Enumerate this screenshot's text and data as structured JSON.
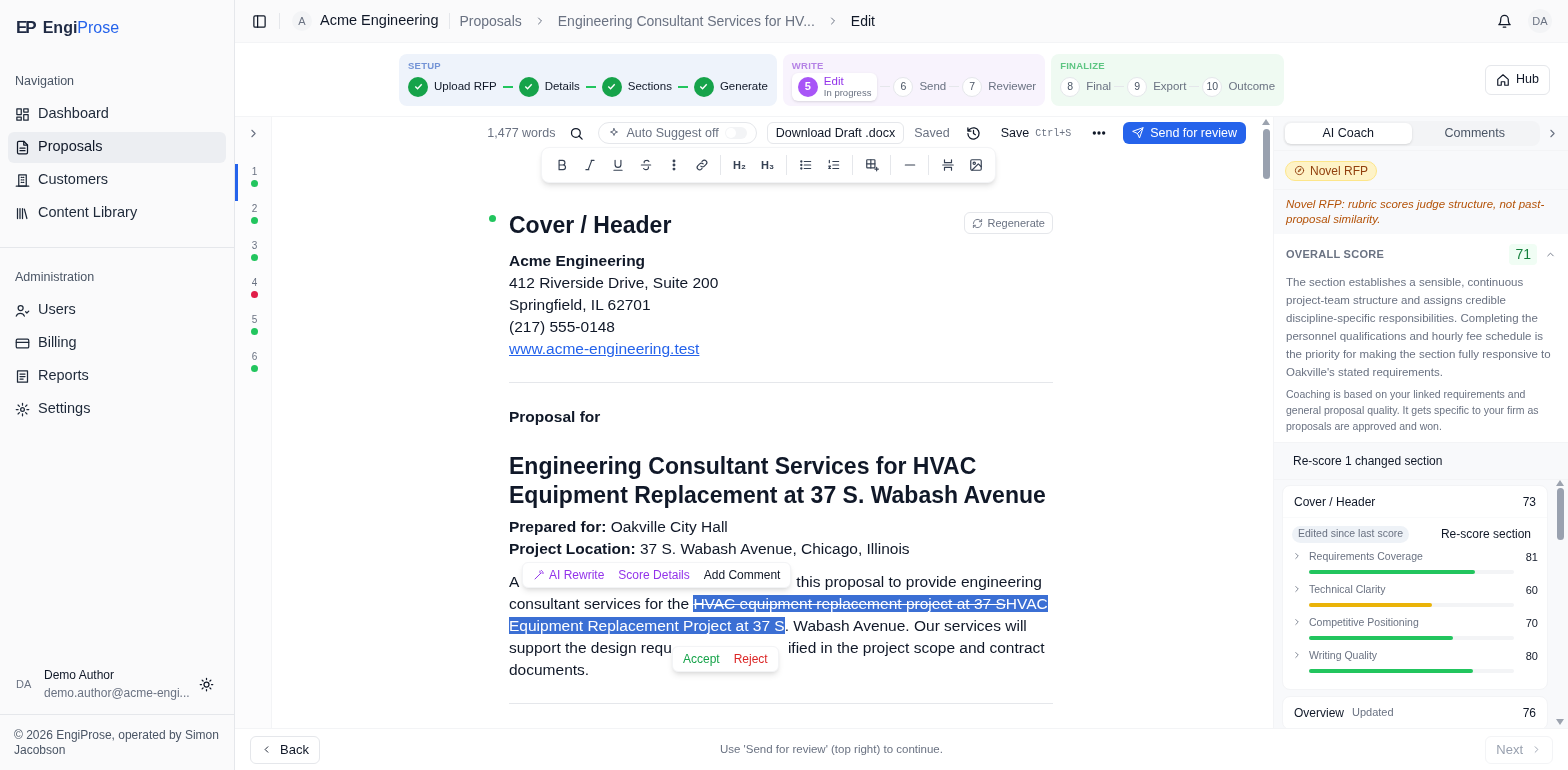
{
  "sidebar": {
    "logo_mark": "EP",
    "brand_first": "Engi",
    "brand_second": "Prose",
    "sections": [
      {
        "title": "Navigation",
        "items": [
          {
            "label": "Dashboard",
            "selected": false
          },
          {
            "label": "Proposals",
            "selected": true
          },
          {
            "label": "Customers",
            "selected": false
          },
          {
            "label": "Content Library",
            "selected": false
          }
        ]
      },
      {
        "title": "Administration",
        "items": [
          {
            "label": "Users",
            "selected": false
          },
          {
            "label": "Billing",
            "selected": false
          },
          {
            "label": "Reports",
            "selected": false
          },
          {
            "label": "Settings",
            "selected": false
          }
        ]
      }
    ],
    "user": {
      "initials": "DA",
      "name": "Demo Author",
      "email": "demo.author@acme-engi..."
    },
    "copyright": "© 2026 EngiProse, operated by Simon Jacobson"
  },
  "header": {
    "org_initial": "A",
    "org": "Acme Engineering",
    "breadcrumbs": [
      "Proposals",
      "Engineering Consultant Services for HV...",
      "Edit"
    ],
    "avatar": "DA"
  },
  "stepper": {
    "groups": [
      {
        "title": "SETUP",
        "steps": [
          {
            "label": "Upload RFP",
            "completed": true,
            "current": false
          },
          {
            "label": "Details",
            "completed": true,
            "current": false
          },
          {
            "label": "Sections",
            "completed": true,
            "current": false
          },
          {
            "label": "Generate",
            "completed": true,
            "current": false
          }
        ]
      },
      {
        "title": "WRITE",
        "steps": [
          {
            "number": "5",
            "label": "Edit",
            "sublabel": "In progress",
            "completed": false,
            "current": true
          },
          {
            "number": "6",
            "label": "Send",
            "completed": false,
            "current": false
          },
          {
            "number": "7",
            "label": "Reviewer",
            "completed": false,
            "current": false
          }
        ]
      },
      {
        "title": "FINALIZE",
        "steps": [
          {
            "number": "8",
            "label": "Final",
            "completed": false,
            "current": false
          },
          {
            "number": "9",
            "label": "Export",
            "completed": false,
            "current": false
          },
          {
            "number": "10",
            "label": "Outcome",
            "completed": false,
            "current": false
          }
        ]
      }
    ],
    "hub": "Hub"
  },
  "section_rail": [
    {
      "number": "1",
      "selected": true,
      "color": "#22c55e"
    },
    {
      "number": "2",
      "selected": false,
      "color": "#22c55e"
    },
    {
      "number": "3",
      "selected": false,
      "color": "#22c55e"
    },
    {
      "number": "4",
      "selected": false,
      "color": "#e11d48"
    },
    {
      "number": "5",
      "selected": false,
      "color": "#22c55e"
    },
    {
      "number": "6",
      "selected": false,
      "color": "#22c55e"
    }
  ],
  "editor_toolbar": {
    "word_count": "1,477 words",
    "auto_suggest": {
      "label": "Auto Suggest off",
      "on": false
    },
    "download": "Download Draft .docx",
    "save_state": "Saved",
    "save": "Save",
    "save_shortcut": "Ctrl+S",
    "send": "Send for review"
  },
  "format_toolbar": [
    {
      "kind": "bold"
    },
    {
      "kind": "italic"
    },
    {
      "kind": "underline"
    },
    {
      "kind": "strike"
    },
    {
      "kind": "more"
    },
    {
      "kind": "link"
    },
    {
      "kind": "sep"
    },
    {
      "kind": "heading",
      "text": "H₂"
    },
    {
      "kind": "heading",
      "text": "H₃"
    },
    {
      "kind": "sep"
    },
    {
      "kind": "bullets"
    },
    {
      "kind": "numbered"
    },
    {
      "kind": "sep"
    },
    {
      "kind": "table"
    },
    {
      "kind": "sep"
    },
    {
      "kind": "rule"
    },
    {
      "kind": "sep"
    },
    {
      "kind": "split"
    },
    {
      "kind": "image"
    }
  ],
  "document": {
    "section_title": "Cover / Header",
    "regenerate": "Regenerate",
    "address": [
      {
        "kind": "bold",
        "text": "Acme Engineering"
      },
      {
        "kind": "line",
        "text": "412 Riverside Drive, Suite 200"
      },
      {
        "kind": "line",
        "text": "Springfield, IL 62701"
      },
      {
        "kind": "line",
        "text": "(217) 555-0148"
      },
      {
        "kind": "link",
        "text": "www.acme-engineering.test"
      }
    ],
    "proposal_for": "Proposal for",
    "title": "Engineering Consultant Services for HVAC Equipment Replacement at 37 S. Wabash Avenue",
    "details": [
      "**Prepared for:** Oakville City Hall",
      "**Project Location:** 37 S. Wabash Avenue, Chicago, Illinois"
    ],
    "paragraph": [
      {
        "kind": "text",
        "text": "A"
      },
      {
        "kind": "selection_toolbar",
        "actions": [
          {
            "label": "AI Rewrite",
            "icon": true
          },
          {
            "label": "Score Details"
          },
          {
            "label": "Add Comment"
          }
        ]
      },
      {
        "kind": "text",
        "text": "this proposal to provide engineering consultant services for the "
      },
      {
        "kind": "deleted",
        "text": "HVAC equipment replacement project at 37 S"
      },
      {
        "kind": "inserted",
        "text": "HVAC Equipment Replacement Project at 37 S"
      },
      {
        "kind": "text",
        "text": ". Wabash Avenue. Our services will support the design requ"
      },
      {
        "kind": "review_toolbar",
        "actions": [
          {
            "label": "Accept"
          },
          {
            "label": "Reject"
          }
        ]
      },
      {
        "kind": "text",
        "text": "ified in the project scope and contract documents."
      }
    ]
  },
  "coach": {
    "tabs": [
      {
        "label": "AI Coach",
        "selected": true
      },
      {
        "label": "Comments",
        "selected": false
      }
    ],
    "badge": "Novel RFP",
    "note": "Novel RFP: rubric scores judge structure, not past-proposal similarity.",
    "overall": {
      "label": "OVERALL SCORE",
      "score": "71",
      "expanded": true,
      "summary": "The section establishes a sensible, continuous project-team structure and assigns credible discipline-specific responsibilities. Completing the personnel qualifications and hourly fee schedule is the priority for making the section fully responsive to Oakville's stated requirements.",
      "disclaimer": "Coaching is based on your linked requirements and general proposal quality. It gets specific to your firm as proposals are approved and won."
    },
    "rescore_all": "Re-score 1 changed section",
    "cards": [
      {
        "title": "Cover / Header",
        "score": "73",
        "tag": "Edited since last score",
        "action": "Re-score section",
        "criteria": [
          {
            "label": "Requirements Coverage",
            "score": "81",
            "level": 0.81,
            "color": "#22c55e",
            "expanded": false
          },
          {
            "label": "Technical Clarity",
            "score": "60",
            "level": 0.6,
            "color": "#eab308",
            "expanded": false
          },
          {
            "label": "Competitive Positioning",
            "score": "70",
            "level": 0.7,
            "color": "#22c55e",
            "expanded": false
          },
          {
            "label": "Writing Quality",
            "score": "80",
            "level": 0.8,
            "color": "#22c55e",
            "expanded": false
          }
        ]
      },
      {
        "title": "Overview",
        "status": "Updated",
        "score": "76"
      }
    ]
  },
  "footer": {
    "back": "Back",
    "hint": "Use 'Send for review' (top right) to continue.",
    "next": "Next",
    "next_disabled": true
  }
}
